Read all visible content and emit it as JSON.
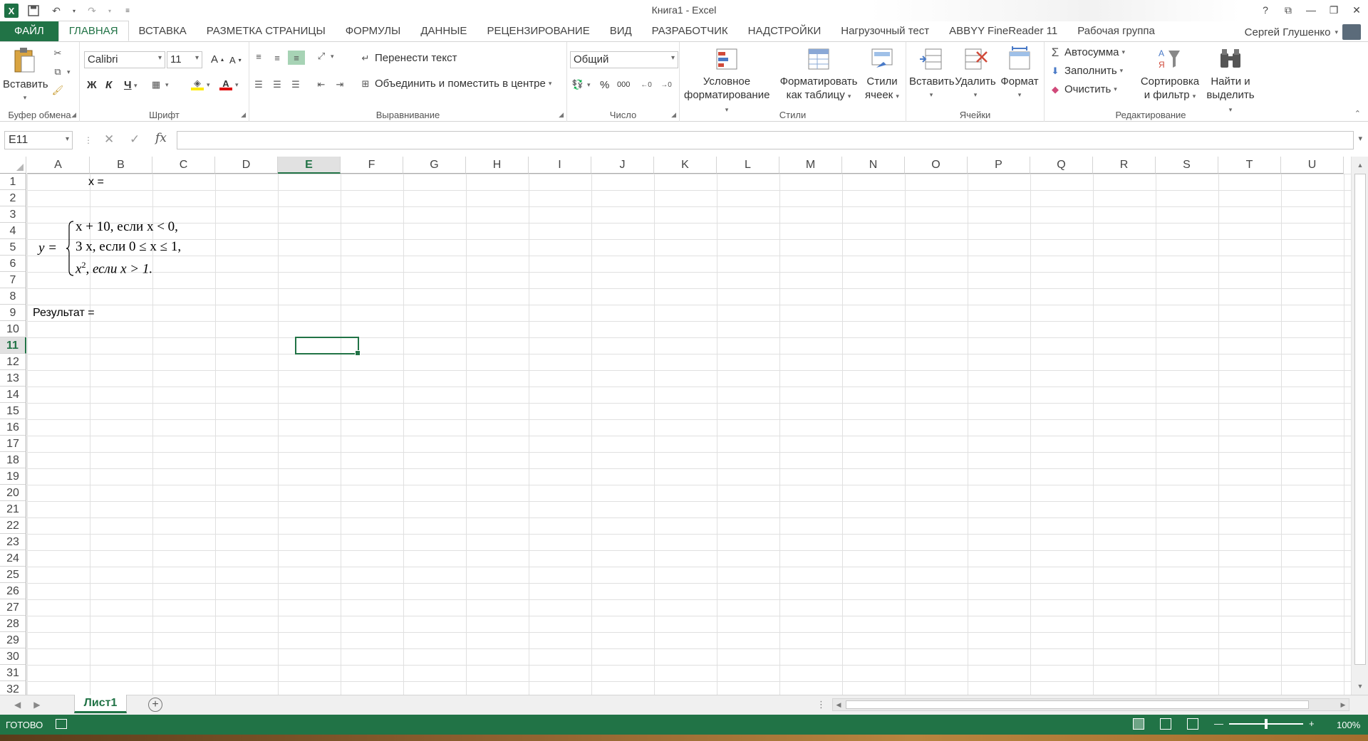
{
  "window": {
    "title": "Книга1 - Excel",
    "controls": [
      "?",
      "⧉",
      "—",
      "❐",
      "✕"
    ]
  },
  "qat": {
    "save": "save-icon",
    "undo": "undo-icon",
    "redo": "redo-icon"
  },
  "tabs": [
    {
      "label": "ФАЙЛ"
    },
    {
      "label": "ГЛАВНАЯ"
    },
    {
      "label": "ВСТАВКА"
    },
    {
      "label": "РАЗМЕТКА СТРАНИЦЫ"
    },
    {
      "label": "ФОРМУЛЫ"
    },
    {
      "label": "ДАННЫЕ"
    },
    {
      "label": "РЕЦЕНЗИРОВАНИЕ"
    },
    {
      "label": "ВИД"
    },
    {
      "label": "РАЗРАБОТЧИК"
    },
    {
      "label": "НАДСТРОЙКИ"
    },
    {
      "label": "Нагрузочный тест"
    },
    {
      "label": "ABBYY FineReader 11"
    },
    {
      "label": "Рабочая группа"
    }
  ],
  "user": {
    "name": "Сергей Глушенко"
  },
  "ribbon": {
    "clipboard": {
      "label": "Буфер обмена",
      "paste": "Вставить"
    },
    "font": {
      "label": "Шрифт",
      "name": "Calibri",
      "size": "11",
      "bold": "Ж",
      "italic": "К",
      "underline": "Ч",
      "grow": "A",
      "shrink": "A",
      "fontcolor": "A"
    },
    "alignment": {
      "label": "Выравнивание",
      "wrap": "Перенести текст",
      "merge": "Объединить и поместить в центре"
    },
    "number": {
      "label": "Число",
      "format": "Общий",
      "percent": "%",
      "thousands": "000"
    },
    "styles": {
      "label": "Стили",
      "conditional_1": "Условное",
      "conditional_2": "форматирование",
      "table_1": "Форматировать",
      "table_2": "как таблицу",
      "cell_1": "Стили",
      "cell_2": "ячеек"
    },
    "cells": {
      "label": "Ячейки",
      "insert": "Вставить",
      "delete": "Удалить",
      "format": "Формат"
    },
    "editing": {
      "label": "Редактирование",
      "autosum": "Автосумма",
      "fill": "Заполнить",
      "clear": "Очистить",
      "sort_1": "Сортировка",
      "sort_2": "и фильтр",
      "find_1": "Найти и",
      "find_2": "выделить"
    }
  },
  "formula_bar": {
    "name_box": "E11",
    "content": ""
  },
  "columns": [
    "A",
    "B",
    "C",
    "D",
    "E",
    "F",
    "G",
    "H",
    "I",
    "J",
    "K",
    "L",
    "M",
    "N",
    "O",
    "P",
    "Q",
    "R",
    "S",
    "T",
    "U"
  ],
  "rows": [
    "1",
    "2",
    "3",
    "4",
    "5",
    "6",
    "7",
    "8",
    "9",
    "10",
    "11",
    "12",
    "13",
    "14",
    "15",
    "16",
    "17",
    "18",
    "19",
    "20",
    "21",
    "22",
    "23",
    "24",
    "25",
    "26",
    "27",
    "28",
    "29",
    "30",
    "31",
    "32"
  ],
  "selected": {
    "column": "E",
    "row": "11"
  },
  "cells": {
    "a1": "x =",
    "a9": "Результат ="
  },
  "formula_image": {
    "lhs": "y =",
    "line1": "x + 10,  если x  < 0,",
    "line2": "3 x,  если 0 ≤ x ≤ 1,",
    "line3_base": "x",
    "line3_exp": "2",
    "line3_rest": ",  если x > 1."
  },
  "sheets": [
    {
      "name": "Лист1",
      "active": true
    }
  ],
  "status": {
    "ready": "ГОТОВО",
    "zoom": "100%",
    "zoom_level_percent": 100
  },
  "colors": {
    "accent": "#217346",
    "selection": "#217346"
  }
}
